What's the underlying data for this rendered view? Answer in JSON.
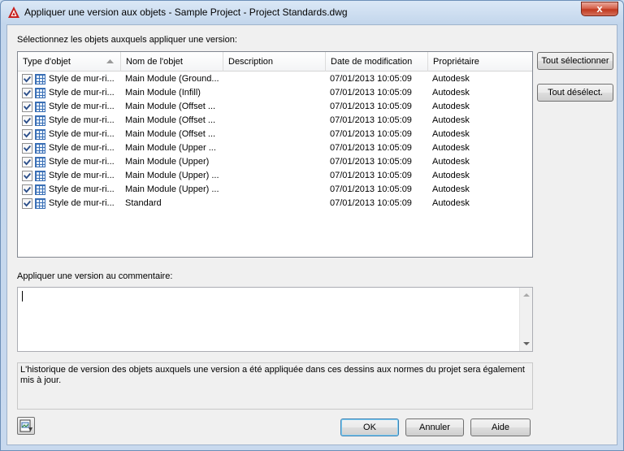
{
  "window": {
    "title": "Appliquer une version aux objets - Sample Project - Project Standards.dwg",
    "close_label": "x"
  },
  "objects_label": "Sélectionnez les objets auxquels appliquer une version:",
  "columns": [
    "Type d'objet",
    "Nom de l'objet",
    "Description",
    "Date de modification",
    "Propriétaire"
  ],
  "rows": [
    {
      "type": "Style de mur-ri...",
      "name": "Main Module (Ground...",
      "description": "",
      "date": "07/01/2013 10:05:09",
      "owner": "Autodesk",
      "checked": true
    },
    {
      "type": "Style de mur-ri...",
      "name": "Main Module (Infill)",
      "description": "",
      "date": "07/01/2013 10:05:09",
      "owner": "Autodesk",
      "checked": true
    },
    {
      "type": "Style de mur-ri...",
      "name": "Main Module (Offset ...",
      "description": "",
      "date": "07/01/2013 10:05:09",
      "owner": "Autodesk",
      "checked": true
    },
    {
      "type": "Style de mur-ri...",
      "name": "Main Module (Offset ...",
      "description": "",
      "date": "07/01/2013 10:05:09",
      "owner": "Autodesk",
      "checked": true
    },
    {
      "type": "Style de mur-ri...",
      "name": "Main Module (Offset ...",
      "description": "",
      "date": "07/01/2013 10:05:09",
      "owner": "Autodesk",
      "checked": true
    },
    {
      "type": "Style de mur-ri...",
      "name": "Main Module (Upper ...",
      "description": "",
      "date": "07/01/2013 10:05:09",
      "owner": "Autodesk",
      "checked": true
    },
    {
      "type": "Style de mur-ri...",
      "name": "Main Module (Upper)",
      "description": "",
      "date": "07/01/2013 10:05:09",
      "owner": "Autodesk",
      "checked": true
    },
    {
      "type": "Style de mur-ri...",
      "name": "Main Module (Upper) ...",
      "description": "",
      "date": "07/01/2013 10:05:09",
      "owner": "Autodesk",
      "checked": true
    },
    {
      "type": "Style de mur-ri...",
      "name": "Main Module (Upper) ...",
      "description": "",
      "date": "07/01/2013 10:05:09",
      "owner": "Autodesk",
      "checked": true
    },
    {
      "type": "Style de mur-ri...",
      "name": "Standard",
      "description": "",
      "date": "07/01/2013 10:05:09",
      "owner": "Autodesk",
      "checked": true
    }
  ],
  "buttons": {
    "select_all": "Tout sélectionner",
    "deselect_all": "Tout désélect.",
    "ok": "OK",
    "cancel": "Annuler",
    "help": "Aide"
  },
  "comment_label": "Appliquer une version au commentaire:",
  "comment_value": "",
  "info_text": "L'historique de version des objets auxquels une version a été appliquée dans ces dessins aux normes du projet sera également mis à jour.",
  "colors": {
    "accent": "#c0391f",
    "checkbox": "#2c4f8a",
    "style_icon": "#3a6fb5"
  },
  "icons": [
    "autocad-logo-icon",
    "close-icon",
    "sort-ascending-icon",
    "checkbox-checked-icon",
    "curtain-wall-style-icon",
    "scroll-up-icon",
    "scroll-down-icon",
    "drawing-properties-icon"
  ]
}
